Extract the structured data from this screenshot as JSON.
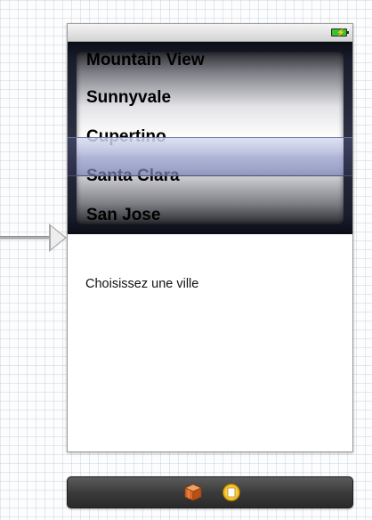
{
  "picker": {
    "rows": [
      {
        "label": "Mountain View",
        "selected": false
      },
      {
        "label": "Sunnyvale",
        "selected": false
      },
      {
        "label": "Cupertino",
        "selected": true
      },
      {
        "label": "Santa Clara",
        "selected": false
      },
      {
        "label": "San Jose",
        "selected": false
      }
    ]
  },
  "content": {
    "prompt_label": "Choisissez une ville"
  },
  "status_bar": {
    "battery_icon": "battery-charging-icon",
    "battery_color": "#39c22b"
  },
  "dock": {
    "icons": [
      "first-responder-cube-icon",
      "view-controller-icon"
    ]
  },
  "colors": {
    "selection_tint": "#9aa0d6",
    "picker_frame": "#1a1d2c",
    "dock_background": "#3b3b3b"
  }
}
